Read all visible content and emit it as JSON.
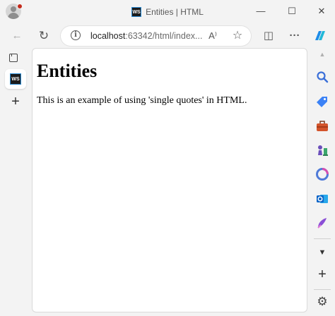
{
  "window": {
    "tab_title": "Entities | HTML",
    "favicon_text": "WS",
    "minimize_glyph": "—",
    "maximize_glyph": "☐",
    "close_glyph": "✕"
  },
  "toolbar": {
    "back_glyph": "←",
    "refresh_glyph": "↻",
    "url_host": "localhost",
    "url_rest": ":63342/html/index...",
    "read_aloud_glyph": "A⁾",
    "favorite_glyph": "☆",
    "split_glyph": "◫",
    "more_glyph": "···"
  },
  "sidebar_left": {
    "active_tab_text": "WS",
    "new_tab_glyph": "+"
  },
  "page": {
    "heading": "Entities",
    "paragraph": "This is an example of using 'single quotes' in HTML."
  },
  "sidebar_right": {
    "up_glyph": "▲",
    "down_glyph": "▼",
    "add_glyph": "+",
    "settings_glyph": "⚙",
    "colors": {
      "copilot": "#1c8ce8",
      "search": "#3a6fd8",
      "tag": "#3b82f6",
      "tools": "#d3542b",
      "games": "#6b4fbb",
      "microsoft365": "#4f7ad8",
      "outlook": "#0a64c8",
      "designer": "#8a4fd6"
    }
  }
}
